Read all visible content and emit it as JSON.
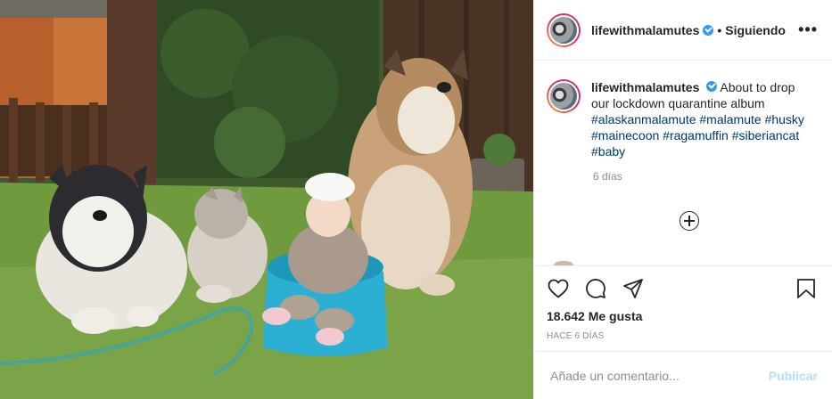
{
  "post": {
    "username": "lifewithmalamutes",
    "follow_status": "Siguiendo",
    "separator": "•",
    "more_glyph": "•••",
    "caption": "About to drop our lockdown quarantine album",
    "hashtags": "#alaskanmalamute #malamute #husky #mainecoon #ragamuffin #siberiancat #baby",
    "caption_time": "6 días",
    "likes": "18.642 Me gusta",
    "posted_ago": "HACE 6 DÍAS"
  },
  "comment_box": {
    "placeholder": "Añade un comentario...",
    "post_label": "Publicar"
  },
  "icons": [
    "heart-icon",
    "comment-icon",
    "share-icon",
    "bookmark-icon",
    "verified-icon",
    "more-options-icon",
    "load-more-comments-icon"
  ],
  "colors": {
    "verified": "#3897f0",
    "hashtag": "#00376b",
    "post_disabled": "#b2dffc",
    "secondary_text": "#8e8e8e"
  }
}
